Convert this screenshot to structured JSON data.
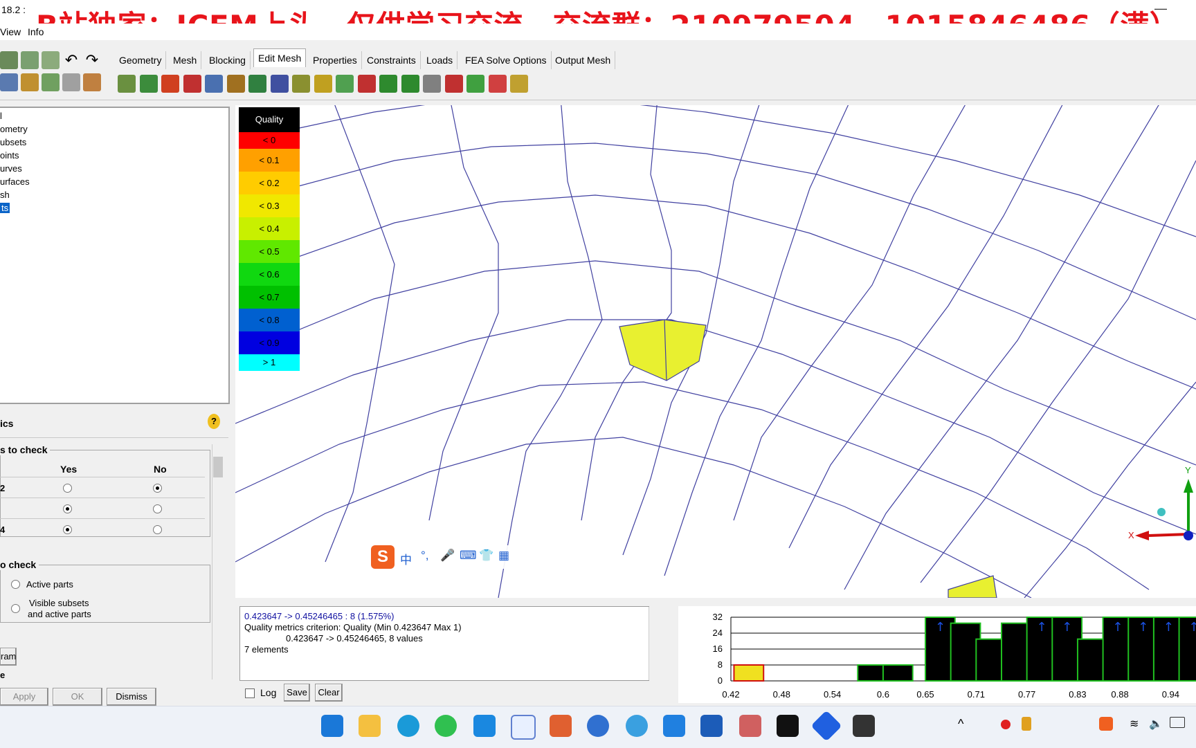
{
  "window": {
    "title": "18.2 :",
    "minimize": "—"
  },
  "banner": "B站独家：ICEM上头，仅供学习交流，交流群：210979504，1015846486（满）",
  "menu": [
    "View",
    "Info"
  ],
  "tabs": [
    "Geometry",
    "Mesh",
    "Blocking",
    "Edit Mesh",
    "Properties",
    "Constraints",
    "Loads",
    "FEA Solve Options",
    "Output Mesh"
  ],
  "active_tab": "Edit Mesh",
  "tree": [
    "l",
    "ometry",
    "ubsets",
    "oints",
    "urves",
    "urfaces",
    "sh",
    "ts"
  ],
  "quality_panel": {
    "title": "ics",
    "group1_title": "s to check",
    "col_yes": "Yes",
    "col_no": "No",
    "rows": [
      {
        "label": "2",
        "yes": false,
        "no": true
      },
      {
        "label": "",
        "yes": true,
        "no": false
      },
      {
        "label": "4",
        "yes": true,
        "no": false
      }
    ],
    "group2_title": "o check",
    "option_active": "Active parts",
    "option_visible_1": "Visible subsets",
    "option_visible_2": "and active parts",
    "ram_button": "ram",
    "e_label": "e",
    "apply": "Apply",
    "ok": "OK",
    "dismiss": "Dismiss"
  },
  "legend": {
    "title": "Quality",
    "items": [
      {
        "label": "< 0",
        "color": "#ff0000"
      },
      {
        "label": "< 0.1",
        "color": "#ffa000"
      },
      {
        "label": "< 0.2",
        "color": "#ffcc00"
      },
      {
        "label": "< 0.3",
        "color": "#f0e800"
      },
      {
        "label": "< 0.4",
        "color": "#c8f000"
      },
      {
        "label": "< 0.5",
        "color": "#60e800"
      },
      {
        "label": "< 0.6",
        "color": "#10d810"
      },
      {
        "label": "< 0.7",
        "color": "#00c000"
      },
      {
        "label": "< 0.8",
        "color": "#0060d0"
      },
      {
        "label": "< 0.9",
        "color": "#0000e0"
      },
      {
        "label": "> 1",
        "color": "#00ffff"
      }
    ]
  },
  "messages": {
    "line1": "0.423647 -> 0.45246465 : 8 (1.575%)",
    "line2": "Quality metrics criterion: Quality (Min 0.423647 Max 1)",
    "line3": "0.423647 -> 0.45246465, 8 values",
    "line4": "7 elements",
    "log_label": "Log",
    "save": "Save",
    "clear": "Clear"
  },
  "histogram": {
    "y_ticks": [
      "32",
      "24",
      "16",
      "8",
      "0"
    ],
    "x_ticks": [
      "0.42",
      "0.48",
      "0.54",
      "0.6",
      "0.65",
      "0.71",
      "0.77",
      "0.83",
      "0.88",
      "0.94"
    ]
  },
  "chart_data": {
    "type": "bar",
    "title": "",
    "xlabel": "",
    "ylabel": "",
    "ylim": [
      0,
      32
    ],
    "bins": [
      {
        "x": 0.423647,
        "value": 8,
        "highlight": true
      },
      {
        "x": 0.57,
        "value": 8
      },
      {
        "x": 0.6,
        "value": 8
      },
      {
        "x": 0.65,
        "value": 32
      },
      {
        "x": 0.68,
        "value": 29
      },
      {
        "x": 0.71,
        "value": 21
      },
      {
        "x": 0.74,
        "value": 29
      },
      {
        "x": 0.77,
        "value": 32
      },
      {
        "x": 0.8,
        "value": 32
      },
      {
        "x": 0.83,
        "value": 21
      },
      {
        "x": 0.86,
        "value": 32
      },
      {
        "x": 0.89,
        "value": 32
      },
      {
        "x": 0.92,
        "value": 32
      },
      {
        "x": 0.95,
        "value": 32
      }
    ]
  },
  "axes_triad": {
    "y": "Y",
    "x": "X"
  },
  "ime_toolbar": {
    "lang": "中"
  },
  "accent": "#0a64c8"
}
